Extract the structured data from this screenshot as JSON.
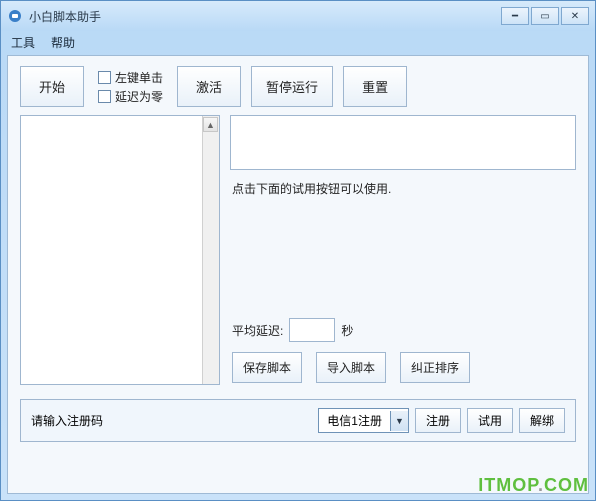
{
  "window": {
    "title": "小白脚本助手"
  },
  "menu": {
    "tools": "工具",
    "help": "帮助"
  },
  "toolbar": {
    "start": "开始",
    "left_click": "左键单击",
    "delay_zero": "延迟为零",
    "activate": "激活",
    "pause": "暂停运行",
    "reset": "重置"
  },
  "main": {
    "hint": "点击下面的试用按钮可以使用.",
    "avg_delay_label": "平均延迟:",
    "avg_delay_value": "",
    "seconds": "秒",
    "save_script": "保存脚本",
    "import_script": "导入脚本",
    "fix_order": "纠正排序"
  },
  "register": {
    "placeholder": "请输入注册码",
    "dropdown_selected": "电信1注册",
    "register_btn": "注册",
    "trial_btn": "试用",
    "unbind_btn": "解绑"
  },
  "watermark": "ITMOP.COM"
}
